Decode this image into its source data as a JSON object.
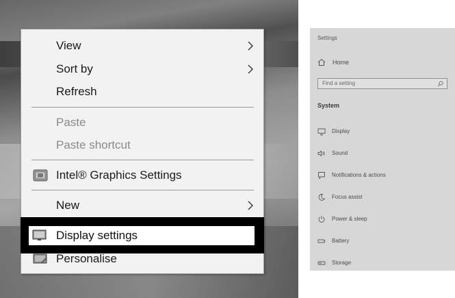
{
  "context_menu": {
    "items": [
      {
        "label": "View",
        "submenu": true,
        "enabled": true
      },
      {
        "label": "Sort by",
        "submenu": true,
        "enabled": true
      },
      {
        "label": "Refresh",
        "submenu": false,
        "enabled": true
      },
      {
        "label": "Paste",
        "submenu": false,
        "enabled": false
      },
      {
        "label": "Paste shortcut",
        "submenu": false,
        "enabled": false
      },
      {
        "label": "Intel® Graphics Settings",
        "submenu": false,
        "enabled": true,
        "icon": "intel-graphics-icon"
      },
      {
        "label": "New",
        "submenu": true,
        "enabled": true
      },
      {
        "label": "Display settings",
        "submenu": false,
        "enabled": true,
        "highlighted": true,
        "icon": "display-icon"
      },
      {
        "label": "Personalise",
        "submenu": false,
        "enabled": true,
        "icon": "personalise-icon"
      }
    ]
  },
  "settings": {
    "title": "Settings",
    "home_label": "Home",
    "search_placeholder": "Find a setting",
    "section_title": "System",
    "items": [
      {
        "label": "Display",
        "icon": "monitor-icon"
      },
      {
        "label": "Sound",
        "icon": "speaker-icon"
      },
      {
        "label": "Notifications & actions",
        "icon": "notification-icon"
      },
      {
        "label": "Focus assist",
        "icon": "moon-icon"
      },
      {
        "label": "Power & sleep",
        "icon": "power-icon"
      },
      {
        "label": "Battery",
        "icon": "battery-icon"
      },
      {
        "label": "Storage",
        "icon": "storage-icon"
      }
    ]
  },
  "colors": {
    "menu_bg": "#f2f2f2",
    "highlight_border": "#000000",
    "settings_bg": "#d7d7d7"
  }
}
